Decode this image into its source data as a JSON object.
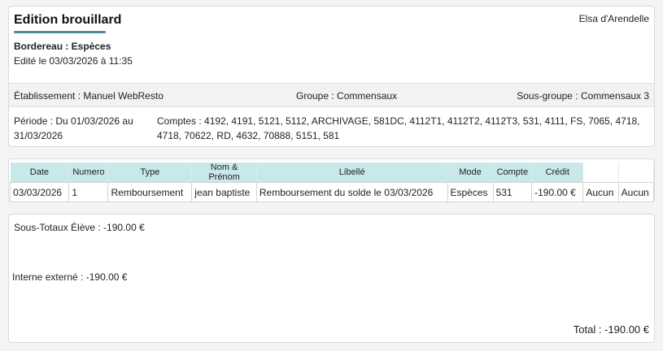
{
  "header": {
    "title": "Edition brouillard",
    "user_name": "Elsa d'Arendelle",
    "subtitle": "Bordereau : Espèces",
    "edited_on": "Edité le 03/03/2026 à 11:35"
  },
  "info_band": {
    "etablissement": "Établissement : Manuel WebResto",
    "groupe": "Groupe : Commensaux",
    "sous_groupe": "Sous-groupe : Commensaux 3"
  },
  "periode": "Période : Du 01/03/2026 au 31/03/2026",
  "comptes": "Comptes : 4192, 4191, 5121, 5112, ARCHIVAGE, 581DC, 4112T1, 4112T2, 4112T3, 531, 4111, FS, 7065, 4718, 4718, 70622, RD, 4632, 70888, 5151, 581",
  "table": {
    "headers": [
      "Date",
      "Numero",
      "Type",
      "Nom & Prénom",
      "Libellé",
      "Mode",
      "Compte",
      "Crédit"
    ],
    "rows": [
      [
        "03/03/2026",
        "1",
        "Remboursement",
        "jean baptiste",
        "Remboursement du solde le 03/03/2026",
        "Espèces",
        "531",
        "-190.00 €",
        "Aucun",
        "Aucun"
      ]
    ]
  },
  "totals": {
    "sous_totaux_eleve": "Sous-Totaux Élève : -190.00 €",
    "interne_externe": "Interne externé : -190.00 €",
    "total": "Total : -190.00 €"
  }
}
